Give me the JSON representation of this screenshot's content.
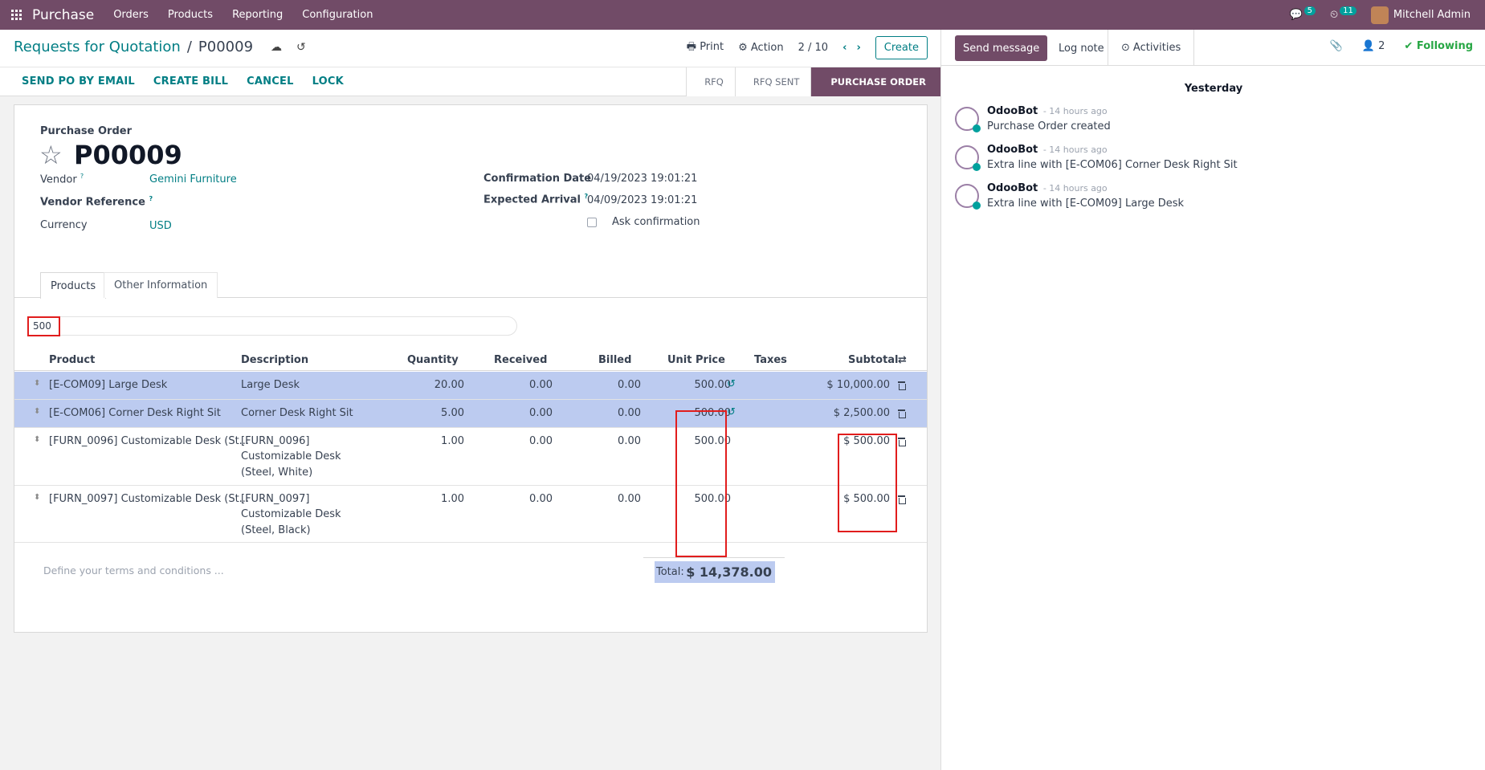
{
  "navbar": {
    "app_name": "Purchase",
    "menu": [
      "Orders",
      "Products",
      "Reporting",
      "Configuration"
    ],
    "messages_count": "5",
    "activities_count": "11",
    "user": "Mitchell Admin"
  },
  "breadcrumb": {
    "parent": "Requests for Quotation",
    "separator": "/",
    "current": "P00009"
  },
  "control_panel": {
    "print": "Print",
    "action": "Action",
    "pager": "2 / 10",
    "create": "Create"
  },
  "actions": [
    "SEND PO BY EMAIL",
    "CREATE BILL",
    "CANCEL",
    "LOCK"
  ],
  "stages": [
    {
      "label": "RFQ",
      "active": false
    },
    {
      "label": "RFQ SENT",
      "active": false
    },
    {
      "label": "PURCHASE ORDER",
      "active": true
    }
  ],
  "form": {
    "title_label": "Purchase Order",
    "name": "P00009",
    "vendor_label": "Vendor",
    "vendor": "Gemini Furniture",
    "vendor_ref_label": "Vendor Reference",
    "currency_label": "Currency",
    "currency": "USD",
    "confirmation_date_label": "Confirmation Date",
    "confirmation_date": "04/19/2023 19:01:21",
    "expected_arrival_label": "Expected Arrival",
    "expected_arrival": "04/09/2023 19:01:21",
    "ask_confirmation_label": "Ask confirmation",
    "help_mark": "?"
  },
  "tabs": [
    "Products",
    "Other Information"
  ],
  "search": {
    "value": "500"
  },
  "table": {
    "headers": [
      "Product",
      "Description",
      "Quantity",
      "Received",
      "Billed",
      "Unit Price",
      "Taxes",
      "Subtotal"
    ],
    "rows": [
      {
        "product": "[E-COM09] Large Desk",
        "description": [
          "Large Desk"
        ],
        "quantity": "20.00",
        "received": "0.00",
        "billed": "0.00",
        "unit_price": "500.00",
        "subtotal": "$ 10,000.00",
        "selected": true
      },
      {
        "product": "[E-COM06] Corner Desk Right Sit",
        "description": [
          "Corner Desk Right Sit"
        ],
        "quantity": "5.00",
        "received": "0.00",
        "billed": "0.00",
        "unit_price": "500.00",
        "subtotal": "$ 2,500.00",
        "selected": true
      },
      {
        "product": "[FURN_0096] Customizable Desk (St...",
        "description": [
          "[FURN_0096]",
          "Customizable Desk",
          "(Steel, White)"
        ],
        "quantity": "1.00",
        "received": "0.00",
        "billed": "0.00",
        "unit_price": "500.00",
        "subtotal": "$ 500.00",
        "selected": false
      },
      {
        "product": "[FURN_0097] Customizable Desk (St...",
        "description": [
          "[FURN_0097]",
          "Customizable Desk",
          "(Steel, Black)"
        ],
        "quantity": "1.00",
        "received": "0.00",
        "billed": "0.00",
        "unit_price": "500.00",
        "subtotal": "$ 500.00",
        "selected": false
      }
    ]
  },
  "footer": {
    "terms_placeholder": "Define your terms and conditions ...",
    "total_label": "Total:",
    "total_value": "$ 14,378.00"
  },
  "chatter": {
    "send_message": "Send message",
    "log_note": "Log note",
    "activities": "Activities",
    "followers_count": "2",
    "following": "Following",
    "day": "Yesterday",
    "messages": [
      {
        "author": "OdooBot",
        "time": "- 14 hours ago",
        "body": "Purchase Order created"
      },
      {
        "author": "OdooBot",
        "time": "- 14 hours ago",
        "body": "Extra line with [E-COM06] Corner Desk Right Sit"
      },
      {
        "author": "OdooBot",
        "time": "- 14 hours ago",
        "body": "Extra line with [E-COM09] Large Desk"
      }
    ]
  },
  "colors": {
    "brand": "#714b67",
    "link": "#017e84",
    "selected_row": "#bccbf0",
    "highlight_box": "#e11d1d",
    "following": "#28a745"
  }
}
